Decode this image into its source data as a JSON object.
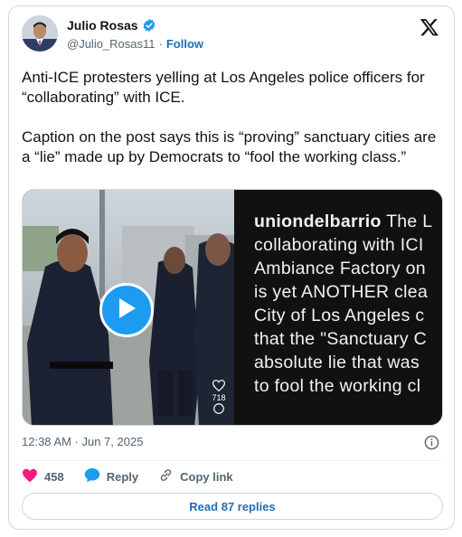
{
  "author": {
    "display_name": "Julio Rosas",
    "handle": "@Julio_Rosas11",
    "separator": "·",
    "follow_label": "Follow"
  },
  "tweet": {
    "paragraphs": [
      "Anti-ICE protesters yelling at Los Angeles police officers for “collaborating” with ICE.",
      "Caption on the post says this is “proving” sanctuary cities are a “lie” made up by Democrats to “fool the working class.”"
    ],
    "timestamp": "12:38 AM · Jun 7, 2025"
  },
  "media": {
    "caption_username": "uniondelbarrio",
    "caption_lines": [
      "The L",
      "collaborating with ICI",
      "Ambiance Factory on",
      "is yet ANOTHER clea",
      "City of Los Angeles c",
      "that the \"Sanctuary C",
      "absolute lie that was",
      "to fool the working cl"
    ],
    "overlay_like_count": "718"
  },
  "actions": {
    "like_count": "458",
    "reply_label": "Reply",
    "copy_link_label": "Copy link"
  },
  "read_replies_label": "Read 87 replies",
  "colors": {
    "like": "#f91880",
    "reply": "#1d9bf0",
    "verified": "#1d9bf0",
    "link": "#1d6fb8"
  }
}
